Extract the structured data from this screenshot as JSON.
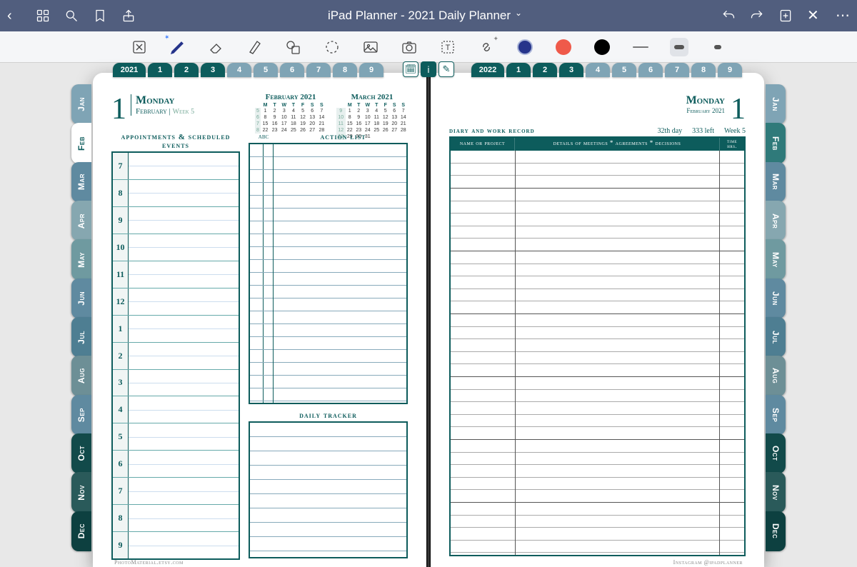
{
  "titlebar": {
    "title": "iPad Planner - 2021 Daily Planner"
  },
  "year_tabs_left": {
    "year": "2021",
    "nums": [
      "1",
      "2",
      "3",
      "4",
      "5",
      "6",
      "7",
      "8",
      "9"
    ]
  },
  "year_tabs_right": {
    "year": "2022",
    "nums": [
      "1",
      "2",
      "3",
      "4",
      "5",
      "6",
      "7",
      "8",
      "9"
    ]
  },
  "months": [
    "Jan",
    "Feb",
    "Mar",
    "Apr",
    "May",
    "Jun",
    "Jul",
    "Aug",
    "Sep",
    "Oct",
    "Nov",
    "Dec"
  ],
  "month_colors": [
    "#7fa4b5",
    "#ffffff",
    "#5f8aa0",
    "#86a7b0",
    "#6f9aa0",
    "#5f8aa0",
    "#4e7e92",
    "#6d8f96",
    "#5f8aa0",
    "#124a4a",
    "#2a5a5a",
    "#0d4040"
  ],
  "month_colors_right": [
    "#7fa4b5",
    "#2f7a7a",
    "#5f8aa0",
    "#86a7b0",
    "#6f9aa0",
    "#5f8aa0",
    "#4e7e92",
    "#6d8f96",
    "#5f8aa0",
    "#124a4a",
    "#2a5a5a",
    "#0d4040"
  ],
  "active_month_index": 1,
  "left_page": {
    "big": "1",
    "day": "Monday",
    "month": "February",
    "week": "Week 5",
    "abc": "abc",
    "action_list": "action  list",
    "daily_tracker": "daily tracker",
    "appts_title": "appointments & scheduled events",
    "hours": [
      "7",
      "8",
      "9",
      "10",
      "11",
      "12",
      "1",
      "2",
      "3",
      "4",
      "5",
      "6",
      "7",
      "8",
      "9"
    ],
    "minical1": {
      "title": "February 2021",
      "dow": [
        "M",
        "T",
        "W",
        "T",
        "F",
        "S",
        "S"
      ],
      "weeks": [
        {
          "wk": "5",
          "d": [
            "1",
            "2",
            "3",
            "4",
            "5",
            "6",
            "7"
          ]
        },
        {
          "wk": "6",
          "d": [
            "8",
            "9",
            "10",
            "11",
            "12",
            "13",
            "14"
          ]
        },
        {
          "wk": "7",
          "d": [
            "15",
            "16",
            "17",
            "18",
            "19",
            "20",
            "21"
          ]
        },
        {
          "wk": "8",
          "d": [
            "22",
            "23",
            "24",
            "25",
            "26",
            "27",
            "28"
          ]
        }
      ]
    },
    "minical2": {
      "title": "March 2021",
      "dow": [
        "M",
        "T",
        "W",
        "T",
        "F",
        "S",
        "S"
      ],
      "weeks": [
        {
          "wk": "9",
          "d": [
            "1",
            "2",
            "3",
            "4",
            "5",
            "6",
            "7"
          ]
        },
        {
          "wk": "10",
          "d": [
            "8",
            "9",
            "10",
            "11",
            "12",
            "13",
            "14"
          ]
        },
        {
          "wk": "11",
          "d": [
            "15",
            "16",
            "17",
            "18",
            "19",
            "20",
            "21"
          ]
        },
        {
          "wk": "12",
          "d": [
            "22",
            "23",
            "24",
            "25",
            "26",
            "27",
            "28"
          ]
        },
        {
          "wk": "13",
          "d": [
            "29",
            "30",
            "31",
            "",
            "",
            "",
            ""
          ]
        }
      ]
    }
  },
  "right_page": {
    "day": "Monday",
    "month": "February 2021",
    "big": "1",
    "diary_title": "diary and work record",
    "nth": "32th day",
    "left": "333 left",
    "week": "Week 5",
    "col1": "name or project",
    "col2": "details of meetings * agreements * decisions",
    "col3": "time hrs."
  },
  "footer": {
    "left": "PhotoMaterial.etsy.com",
    "right": "Instagram @ipadplanner"
  },
  "colors": {
    "navy": "#26348b",
    "red": "#ef5a4a",
    "black": "#000"
  }
}
